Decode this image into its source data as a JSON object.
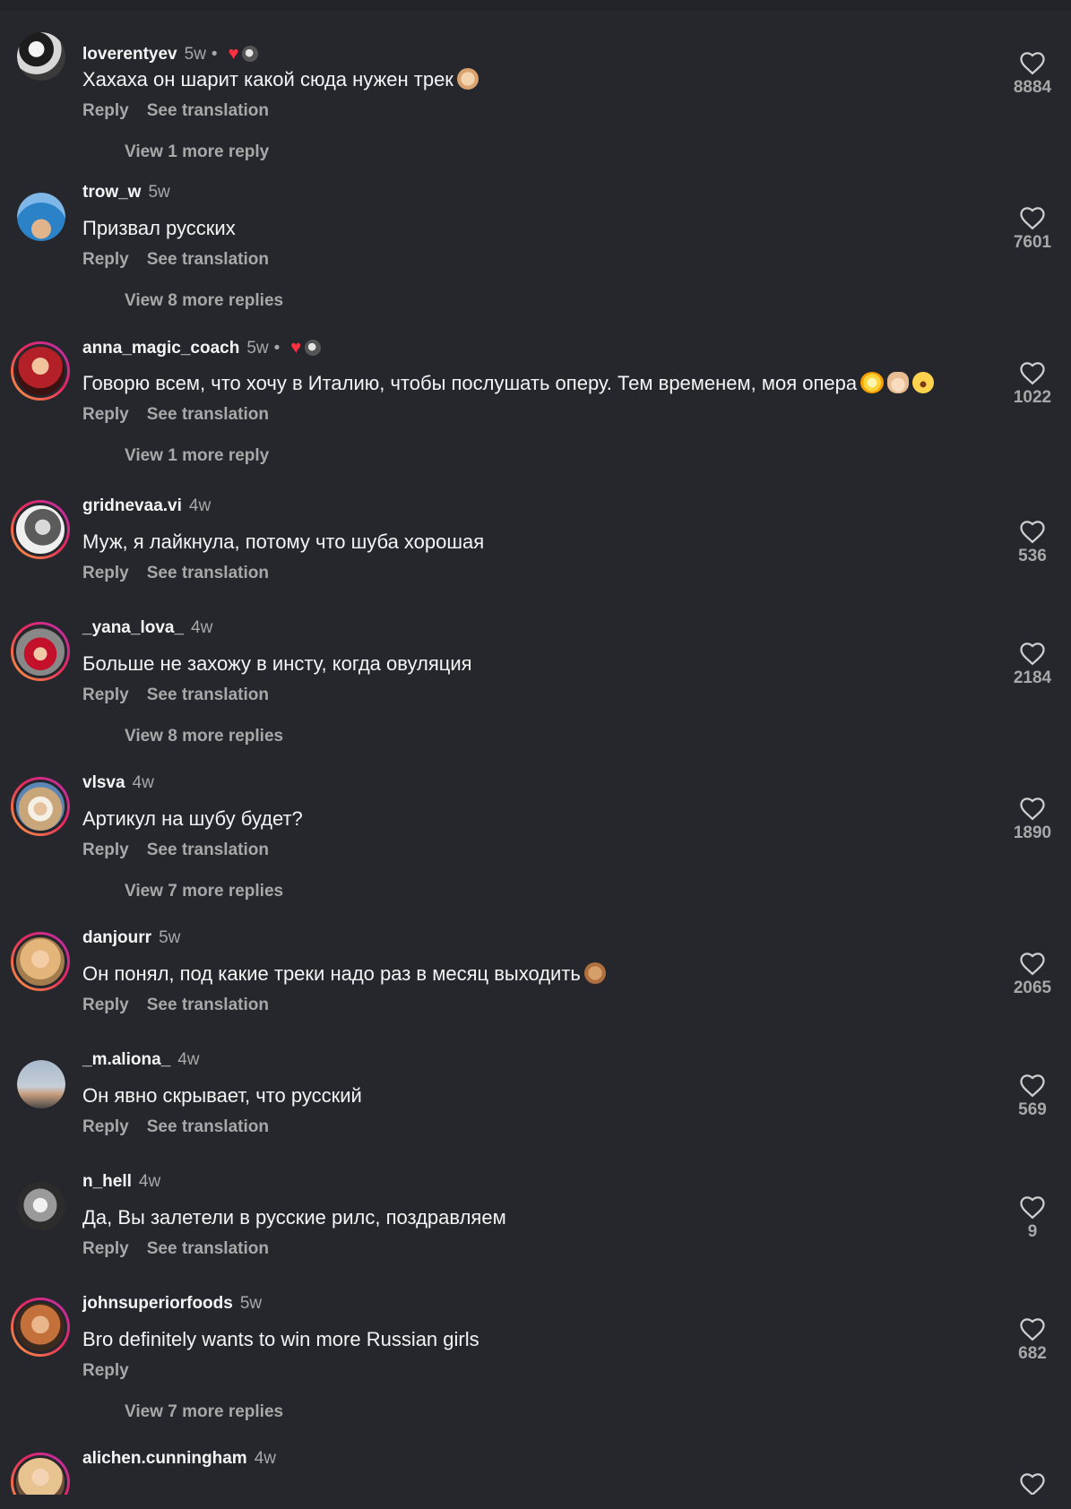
{
  "comments": [
    {
      "username": "loverentyev",
      "time": "5w",
      "author_liked": true,
      "text": "Хахаха он шарит какой сюда нужен трек",
      "emojis": [
        "ok-hand-light"
      ],
      "reply_label": "Reply",
      "translate_label": "See translation",
      "more_replies": "View 1 more reply",
      "likes": "8884"
    },
    {
      "username": "trow_w",
      "time": "5w",
      "author_liked": false,
      "text": "Призвал русских",
      "reply_label": "Reply",
      "translate_label": "See translation",
      "more_replies": "View 8 more replies",
      "likes": "7601"
    },
    {
      "username": "anna_magic_coach",
      "time": "5w",
      "author_liked": true,
      "text": "Говорю всем, что хочу в Италию, чтобы послушать оперу. Тем временем, моя опера",
      "emojis": [
        "dizzy",
        "index-pointing-up",
        "grinning-squinting-face"
      ],
      "reply_label": "Reply",
      "translate_label": "See translation",
      "more_replies": "View 1 more reply",
      "likes": "1022"
    },
    {
      "username": "gridnevaa.vi",
      "time": "4w",
      "author_liked": false,
      "text": "Муж, я лайкнула, потому что шуба хорошая",
      "reply_label": "Reply",
      "translate_label": "See translation",
      "more_replies": "",
      "likes": "536"
    },
    {
      "username": "_yana_lova_",
      "time": "4w",
      "author_liked": false,
      "text": "Больше не захожу в инсту, когда овуляция",
      "reply_label": "Reply",
      "translate_label": "See translation",
      "more_replies": "View 8 more replies",
      "likes": "2184"
    },
    {
      "username": "vlsva",
      "time": "4w",
      "author_liked": false,
      "text": "Артикул на шубу будет?",
      "reply_label": "Reply",
      "translate_label": "See translation",
      "more_replies": "View 7 more replies",
      "likes": "1890"
    },
    {
      "username": "danjourr",
      "time": "5w",
      "author_liked": false,
      "text": "Он понял, под какие треки надо раз в месяц выходить",
      "emojis": [
        "ok-hand-medium"
      ],
      "reply_label": "Reply",
      "translate_label": "See translation",
      "more_replies": "",
      "likes": "2065"
    },
    {
      "username": "_m.aliona_",
      "time": "4w",
      "author_liked": false,
      "text": "Он явно скрывает, что русский",
      "reply_label": "Reply",
      "translate_label": "See translation",
      "more_replies": "",
      "likes": "569"
    },
    {
      "username": "n_hell",
      "time": "4w",
      "author_liked": false,
      "text": "Да, Вы залетели в русские рилс, поздравляем",
      "reply_label": "Reply",
      "translate_label": "See translation",
      "more_replies": "",
      "likes": "9"
    },
    {
      "username": "johnsuperiorfoods",
      "time": "5w",
      "author_liked": false,
      "text": "Bro definitely wants to win more Russian girls",
      "reply_label": "Reply",
      "translate_label": "",
      "more_replies": "View 7 more replies",
      "likes": "682"
    },
    {
      "username": "alichen.cunningham",
      "time": "4w",
      "author_liked": false,
      "text": "",
      "reply_label": "",
      "translate_label": "",
      "more_replies": "",
      "likes": ""
    }
  ],
  "author_liked_icon": "heart-icon",
  "like_icon": "heart-outline-icon",
  "colors": {
    "background": "#25272c",
    "primary_text": "#f4f4f4",
    "secondary_text": "#a8a8a8",
    "liked_heart": "#ff3040",
    "story_ring_start": "#f9a03f",
    "story_ring_end": "#b52fb5"
  }
}
